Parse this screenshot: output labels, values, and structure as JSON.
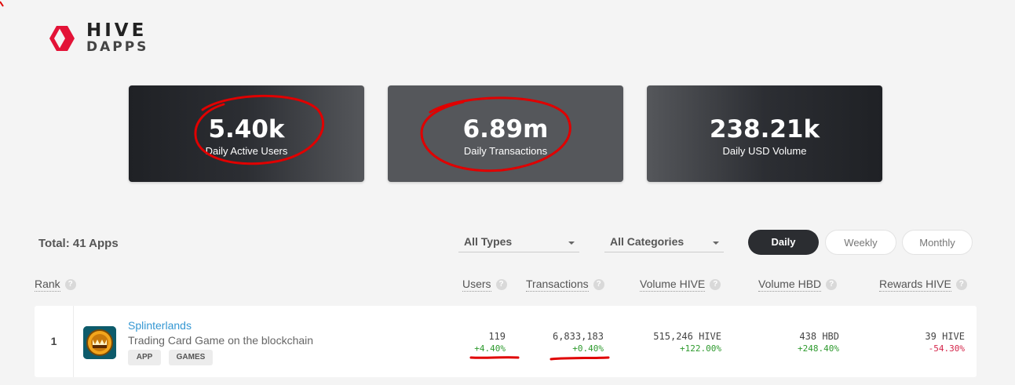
{
  "logo": {
    "line1": "HIVE",
    "line2": "DAPPS"
  },
  "stats": [
    {
      "value": "5.40k",
      "label": "Daily Active Users"
    },
    {
      "value": "6.89m",
      "label": "Daily Transactions"
    },
    {
      "value": "238.21k",
      "label": "Daily USD Volume"
    }
  ],
  "toolbar": {
    "total": "Total: 41 Apps",
    "type_select": "All Types",
    "category_select": "All Categories",
    "periods": [
      "Daily",
      "Weekly",
      "Monthly"
    ],
    "active_period": "Daily"
  },
  "table": {
    "headers": {
      "rank": "Rank",
      "users": "Users",
      "transactions": "Transactions",
      "volume_hive": "Volume HIVE",
      "volume_hbd": "Volume HBD",
      "rewards_hive": "Rewards HIVE"
    },
    "help_glyph": "?",
    "rows": [
      {
        "rank": "1",
        "name": "Splinterlands",
        "description": "Trading Card Game on the blockchain",
        "tags": [
          "APP",
          "GAMES"
        ],
        "users": "119",
        "users_change": "+4.40%",
        "transactions": "6,833,183",
        "transactions_change": "+0.40%",
        "volume_hive": "515,246 HIVE",
        "volume_hive_change": "+122.00%",
        "volume_hbd": "438 HBD",
        "volume_hbd_change": "+248.40%",
        "rewards_hive": "39 HIVE",
        "rewards_hive_change": "-54.30%"
      }
    ]
  },
  "colors": {
    "accent": "#e31337",
    "link": "#3598d3",
    "positive": "#2e9a2e",
    "negative": "#d4254a",
    "annotation": "#e00000"
  },
  "icons": [
    "hive-logo-icon",
    "chevron-down-icon",
    "help-icon",
    "splinterlands-app-icon"
  ]
}
